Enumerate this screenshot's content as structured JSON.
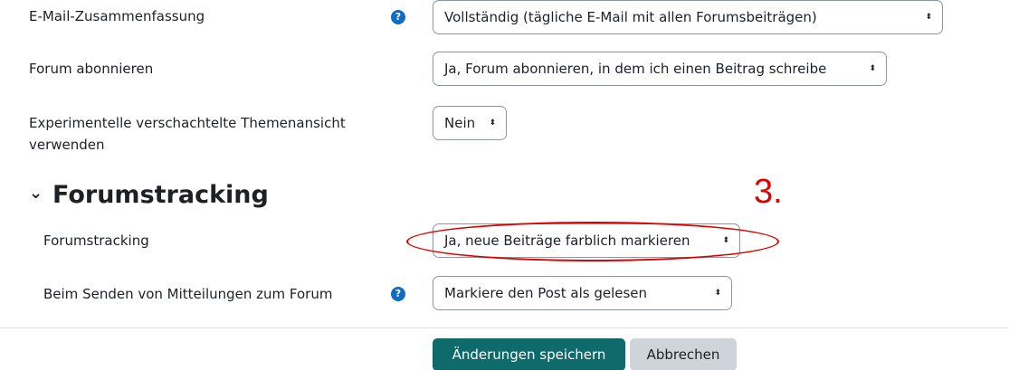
{
  "settings": {
    "email_digest": {
      "label": "E-Mail-Zusammenfassung",
      "value": "Vollständig (tägliche E-Mail mit allen Forumsbeiträgen)",
      "help_icon": "question-circle-icon"
    },
    "subscribe": {
      "label": "Forum abonnieren",
      "value": "Ja, Forum abonnieren, in dem ich einen Beitrag schreibe"
    },
    "nested_view": {
      "label_line1": "Experimentelle verschachtelte Themenansicht",
      "label_line2": "verwenden",
      "value": "Nein"
    }
  },
  "forum_tracking_section": {
    "title": "Forumstracking",
    "collapse_icon": "chevron-down-icon",
    "tracking": {
      "label": "Forumstracking",
      "value": "Ja, neue Beiträge farblich markieren"
    },
    "mark_read": {
      "label": "Beim Senden von Mitteilungen zum Forum",
      "value": "Markiere den Post als gelesen",
      "help_icon": "question-circle-icon"
    }
  },
  "annotation": {
    "number": "3.",
    "color": "#e00000"
  },
  "buttons": {
    "save": "Änderungen speichern",
    "cancel": "Abbrechen"
  },
  "colors": {
    "primary": "#0f6b6b",
    "help": "#0f6cbf",
    "secondary": "#ced4da"
  }
}
